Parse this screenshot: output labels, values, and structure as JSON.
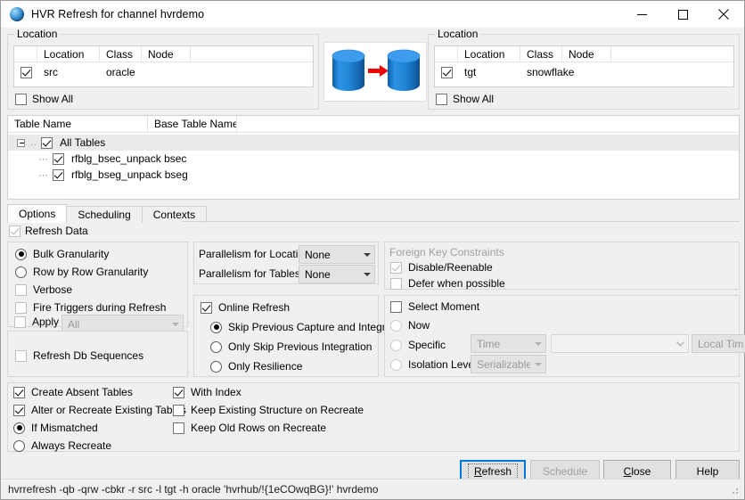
{
  "window": {
    "title": "HVR Refresh for channel hvrdemo",
    "icon": "hvr-sphere-icon",
    "controls": {
      "minimize": "minimize-icon",
      "maximize": "maximize-icon",
      "close": "close-icon"
    }
  },
  "source_location": {
    "legend": "Location",
    "columns": [
      "Location",
      "Class",
      "Node"
    ],
    "rows": [
      {
        "checked": true,
        "location": "src",
        "class": "oracle",
        "node": ""
      }
    ],
    "show_all_label": "Show All",
    "show_all_checked": false
  },
  "target_location": {
    "legend": "Location",
    "columns": [
      "Location",
      "Class",
      "Node"
    ],
    "rows": [
      {
        "checked": true,
        "location": "tgt",
        "class": "snowflake",
        "node": ""
      }
    ],
    "show_all_label": "Show All",
    "show_all_checked": false
  },
  "transfer_graphic": {
    "source_icon": "database-cylinder-icon",
    "arrow_icon": "arrow-right-icon",
    "target_icon": "database-cylinder-icon",
    "cylinder_color": "#1f86d8",
    "arrow_color": "#ef0000"
  },
  "tables": {
    "columns": [
      "Table Name",
      "Base Table Name"
    ],
    "root": {
      "label": "All Tables",
      "checked": true,
      "expanded": true
    },
    "items": [
      {
        "label": "rfblg_bsec_unpack bsec",
        "checked": true
      },
      {
        "label": "rfblg_bseg_unpack bseg",
        "checked": true
      }
    ]
  },
  "tabs": [
    {
      "label": "Options",
      "active": true
    },
    {
      "label": "Scheduling",
      "active": false
    },
    {
      "label": "Contexts",
      "active": false
    }
  ],
  "options": {
    "refresh_data": {
      "label": "Refresh Data",
      "checked": true,
      "disabled": true
    },
    "granularity": {
      "bulk": {
        "label": "Bulk Granularity",
        "selected": true
      },
      "row_by_row": {
        "label": "Row by Row Granularity",
        "selected": false
      },
      "verbose": {
        "label": "Verbose",
        "checked": false,
        "disabled": true
      },
      "fire_triggers": {
        "label": "Fire Triggers during Refresh",
        "checked": false,
        "disabled": true
      },
      "apply": {
        "label": "Apply",
        "checked": false,
        "disabled": true,
        "value": "All"
      }
    },
    "refresh_db_sequences": {
      "label": "Refresh Db Sequences",
      "checked": false,
      "disabled": true
    },
    "parallelism": {
      "locations_label": "Parallelism for Locations",
      "locations_value": "None",
      "tables_label": "Parallelism for Tables",
      "tables_value": "None"
    },
    "online_refresh": {
      "label": "Online Refresh",
      "checked": true,
      "choices": [
        {
          "label": "Skip Previous Capture and Integration",
          "selected": true
        },
        {
          "label": "Only Skip Previous Integration",
          "selected": false
        },
        {
          "label": "Only Resilience",
          "selected": false
        }
      ]
    },
    "foreign_key": {
      "legend": "Foreign Key Constraints",
      "disable_reenable": {
        "label": "Disable/Reenable",
        "checked": true,
        "disabled": true
      },
      "defer": {
        "label": "Defer when possible",
        "checked": false,
        "disabled": true
      }
    },
    "select_moment": {
      "label": "Select Moment",
      "checked": false,
      "now": {
        "label": "Now",
        "selected": false,
        "disabled": true
      },
      "specific": {
        "label": "Specific",
        "selected": false,
        "disabled": true
      },
      "specific_type_value": "Time",
      "specific_value": "",
      "timezone_value": "Local Time",
      "isolation": {
        "label": "Isolation Level",
        "selected": false,
        "disabled": true
      },
      "isolation_value": "Serializable"
    },
    "create_tables": {
      "create_absent": {
        "label": "Create Absent Tables",
        "checked": true
      },
      "alter_recreate": {
        "label": "Alter or Recreate Existing Tables",
        "checked": true
      },
      "if_mismatched": {
        "label": "If Mismatched",
        "selected": true
      },
      "always_recreate": {
        "label": "Always Recreate",
        "selected": false
      },
      "with_index": {
        "label": "With Index",
        "checked": true
      },
      "keep_structure": {
        "label": "Keep Existing Structure on Recreate",
        "checked": false
      },
      "keep_old_rows": {
        "label": "Keep Old Rows on Recreate",
        "checked": false
      }
    }
  },
  "buttons": {
    "refresh": {
      "label": "Refresh",
      "accel": "R",
      "disabled": false,
      "focused": true
    },
    "schedule": {
      "label": "Schedule",
      "disabled": true
    },
    "close": {
      "label": "Close",
      "accel": "C",
      "disabled": false
    },
    "help": {
      "label": "Help",
      "disabled": false
    }
  },
  "status_bar": {
    "command": "hvrrefresh -qb -qrw -cbkr -r src -l tgt -h oracle 'hvrhub/!{1eCOwqBG}!' hvrdemo"
  }
}
